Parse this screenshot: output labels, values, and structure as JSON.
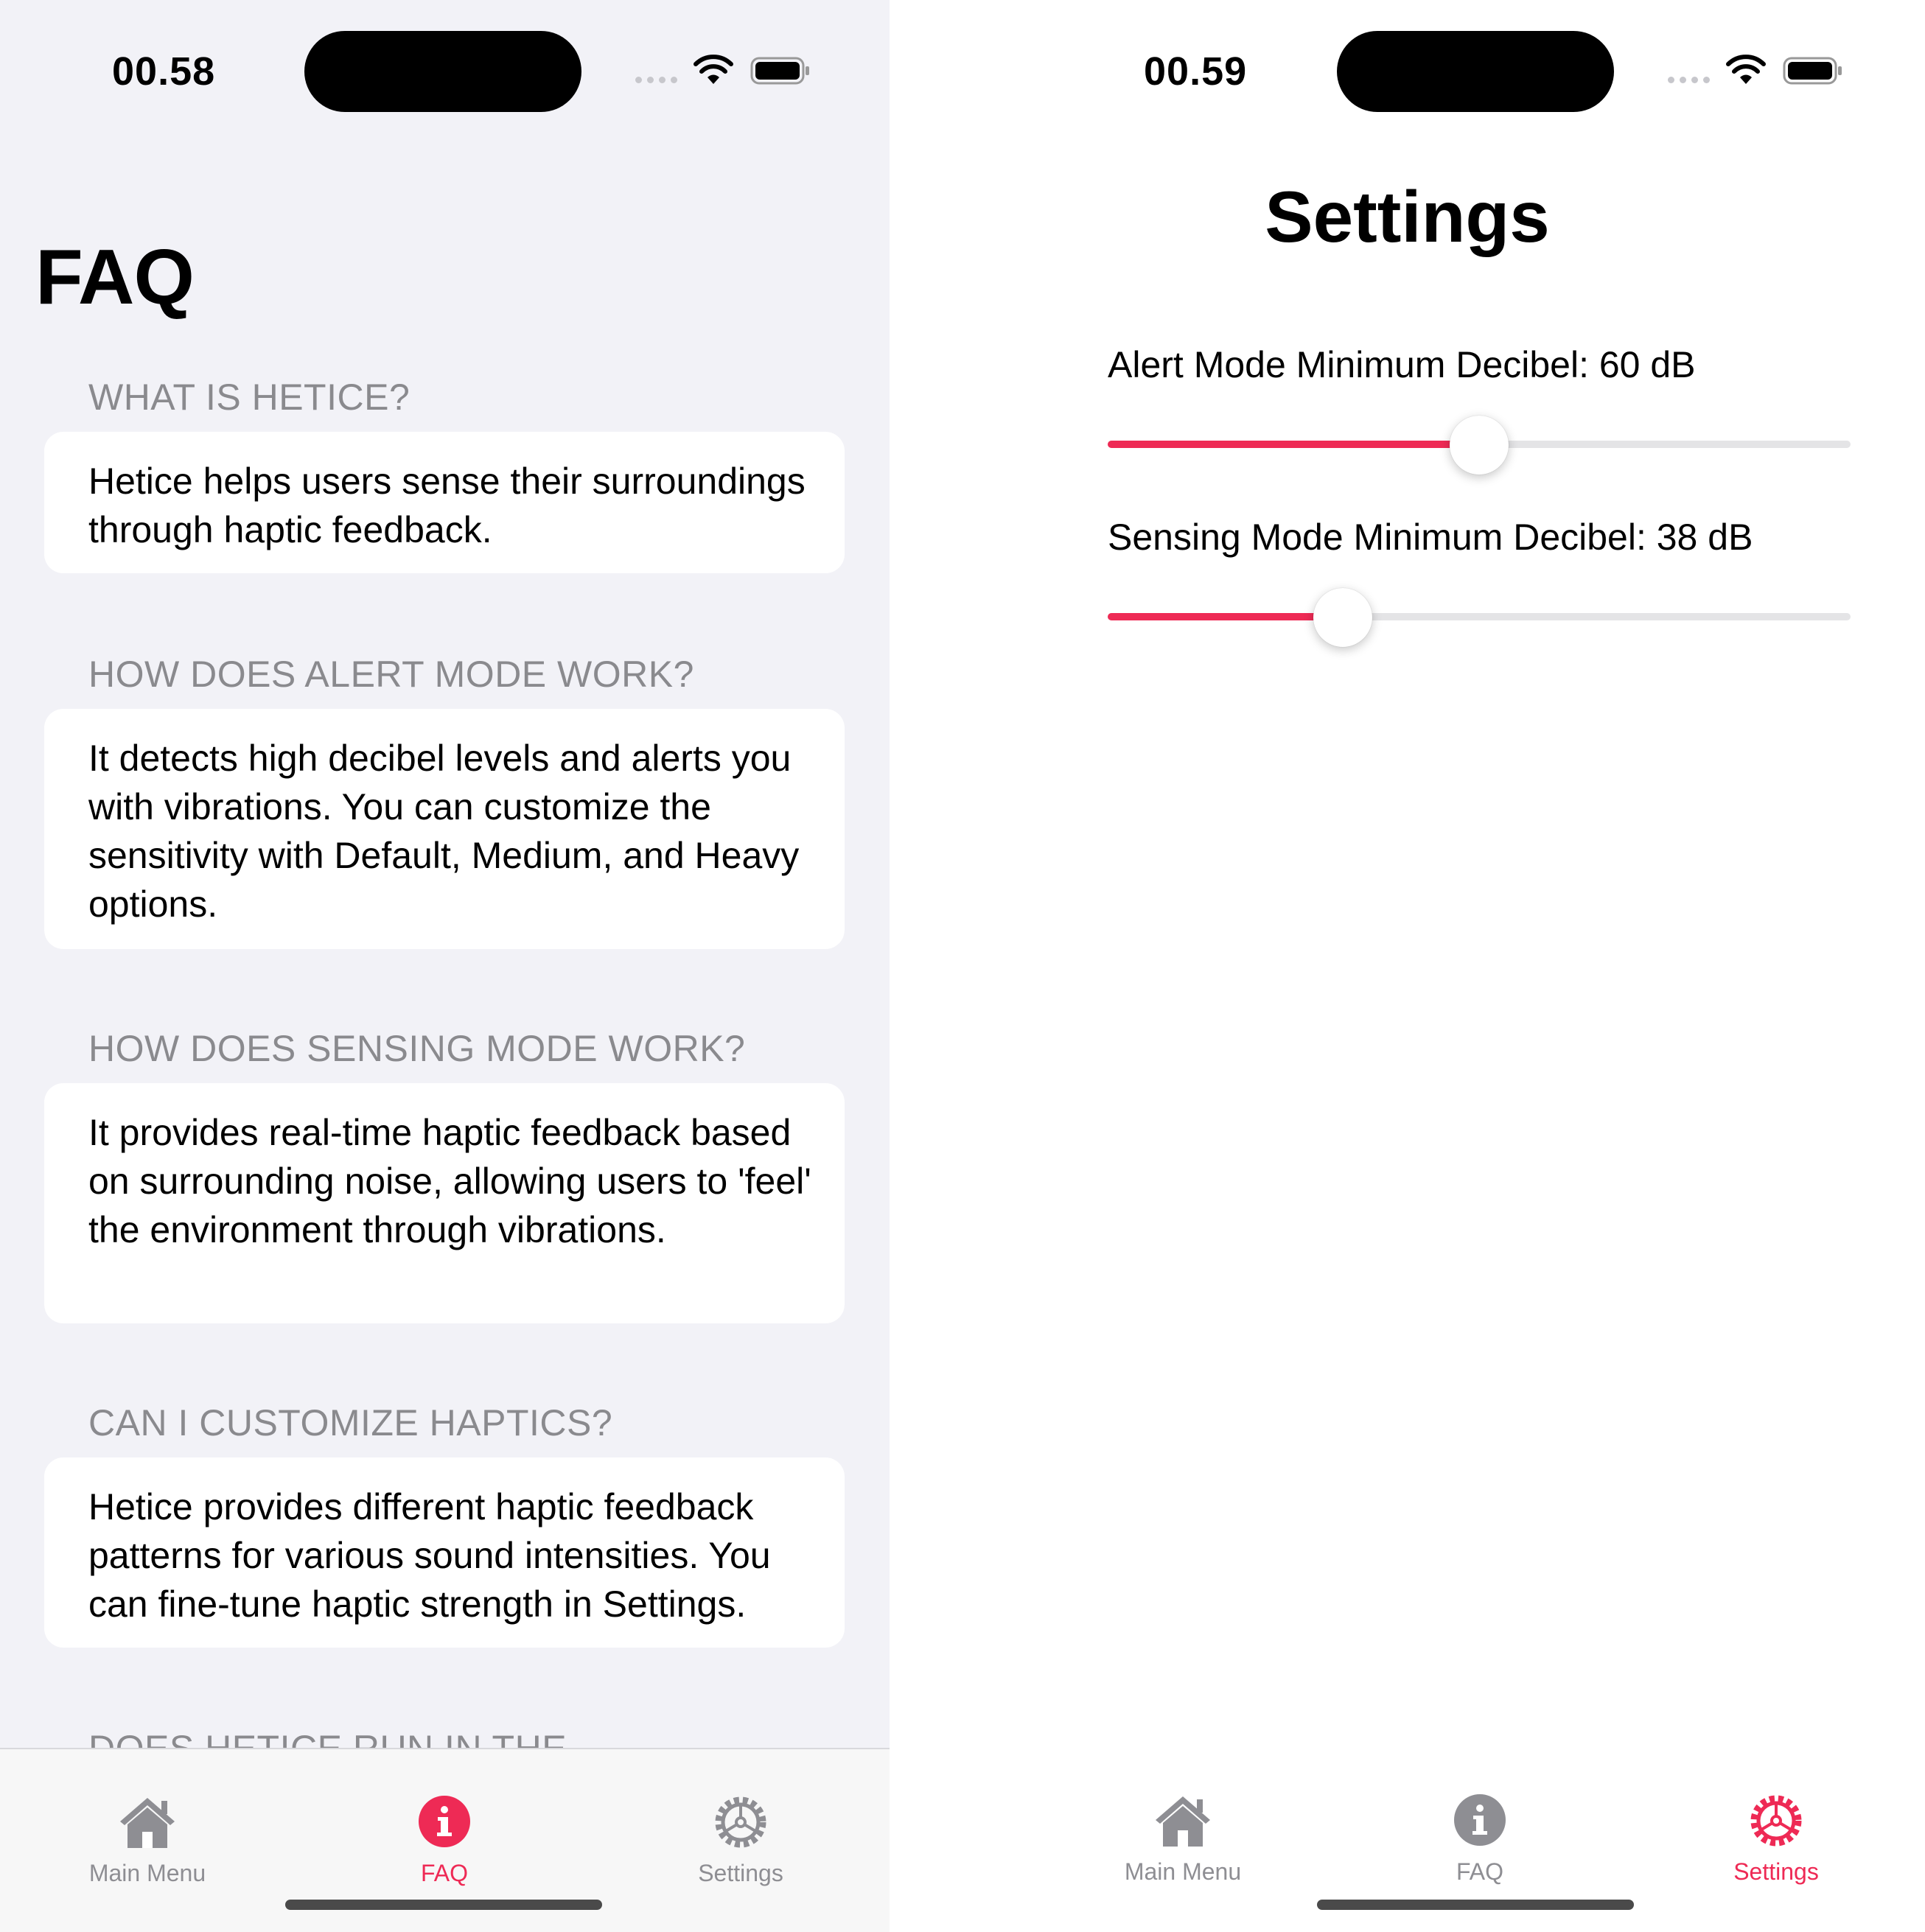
{
  "faq_screen": {
    "status": {
      "time": "00.58"
    },
    "title": "FAQ",
    "items": [
      {
        "question": "WHAT IS HETICE?",
        "answer": "Hetice helps users sense their surroundings through haptic feedback."
      },
      {
        "question": "HOW DOES ALERT MODE WORK?",
        "answer": "It detects high decibel levels and alerts you with vibrations. You can customize the sensitivity with Default, Medium, and Heavy options."
      },
      {
        "question": "HOW DOES SENSING MODE WORK?",
        "answer": "It provides real-time haptic feedback based on surrounding noise, allowing users to 'feel' the environment through vibrations."
      },
      {
        "question": "CAN I CUSTOMIZE HAPTICS?",
        "answer": "Hetice provides different haptic feedback patterns for various sound intensities. You can fine-tune haptic strength in Settings."
      },
      {
        "question": "DOES HETICE RUN IN THE"
      }
    ],
    "tabs": [
      {
        "label": "Main Menu",
        "icon": "house-icon",
        "active": false
      },
      {
        "label": "FAQ",
        "icon": "info-circle-icon",
        "active": true
      },
      {
        "label": "Settings",
        "icon": "gear-icon",
        "active": false
      }
    ]
  },
  "settings_screen": {
    "status": {
      "time": "00.59"
    },
    "title": "Settings",
    "alert_slider": {
      "label": "Alert Mode Minimum Decibel: 60 dB",
      "value": 60
    },
    "sensing_slider": {
      "label": "Sensing Mode Minimum Decibel: 38 dB",
      "value": 38
    },
    "tabs": [
      {
        "label": "Main Menu",
        "icon": "house-icon",
        "active": false
      },
      {
        "label": "FAQ",
        "icon": "info-circle-icon",
        "active": false
      },
      {
        "label": "Settings",
        "icon": "gear-icon",
        "active": true
      }
    ]
  },
  "colors": {
    "accent": "#ee2a55",
    "inactive": "#8e8e93",
    "faq_background": "#f2f2f7"
  }
}
